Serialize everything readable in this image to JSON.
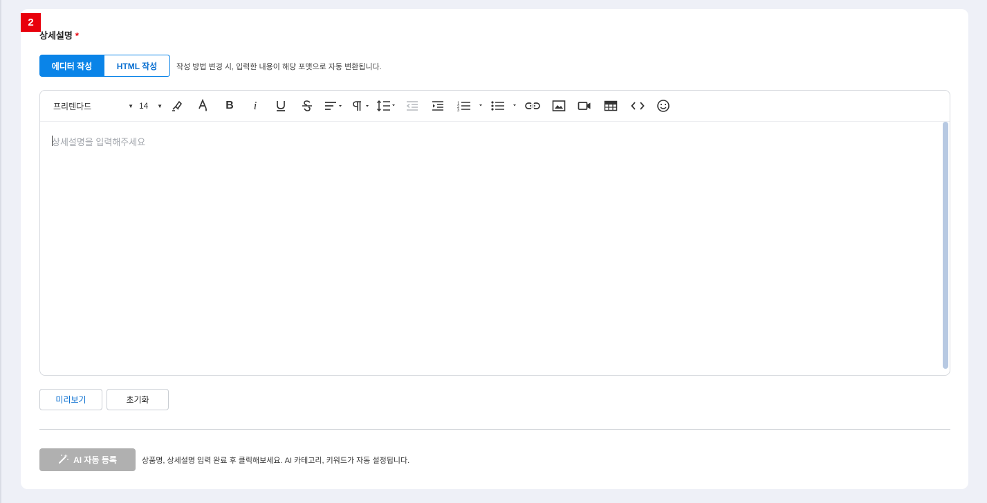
{
  "step_badge": "2",
  "section": {
    "title": "상세설명",
    "required_mark": "*"
  },
  "mode_toggle": {
    "editor_label": "에디터 작성",
    "html_label": "HTML 작성",
    "selected": "에디터 작성",
    "hint": "작성 방법 변경 시, 입력한 내용이 해당 포맷으로 자동 변환됩니다."
  },
  "toolbar": {
    "font_family": "프리텐다드",
    "font_size": "14",
    "icons": [
      "highlighter-icon",
      "text-color-icon",
      "bold-icon",
      "italic-icon",
      "underline-icon",
      "strikethrough-icon",
      "align-icon",
      "paragraph-icon",
      "line-height-icon",
      "outdent-icon",
      "indent-icon",
      "ordered-list-icon",
      "unordered-list-icon",
      "link-icon",
      "image-icon",
      "video-icon",
      "table-icon",
      "code-view-icon",
      "emoji-icon"
    ]
  },
  "editor": {
    "placeholder": "상세설명을 입력해주세요",
    "content": ""
  },
  "buttons": {
    "preview": "미리보기",
    "reset": "초기화"
  },
  "ai": {
    "button_label": "AI 자동 등록",
    "hint": "상품명, 상세설명 입력 완료 후 클릭해보세요. AI 카테고리, 키워드가 자동 설정됩니다."
  },
  "colors": {
    "accent": "#0a84e8",
    "required": "#e8000b",
    "disabled": "#b0b0b0",
    "scroll_thumb": "#b7c9e2",
    "page_bg": "#eef0f7"
  }
}
